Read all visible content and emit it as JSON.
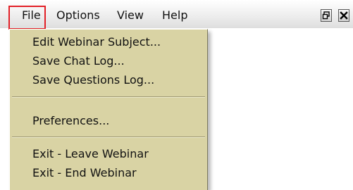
{
  "menubar": {
    "items": [
      {
        "label": "File"
      },
      {
        "label": "Options"
      },
      {
        "label": "View"
      },
      {
        "label": "Help"
      }
    ]
  },
  "window_buttons": {
    "restore": "restore-icon",
    "close": "close-icon"
  },
  "file_menu": {
    "groups": [
      [
        "Edit Webinar Subject...",
        "Save Chat Log...",
        "Save Questions Log..."
      ],
      [
        "Preferences..."
      ],
      [
        "Exit - Leave Webinar",
        "Exit - End Webinar"
      ]
    ]
  },
  "colors": {
    "menu_background": "#d9d3a4",
    "highlight_border": "#e21f26"
  }
}
